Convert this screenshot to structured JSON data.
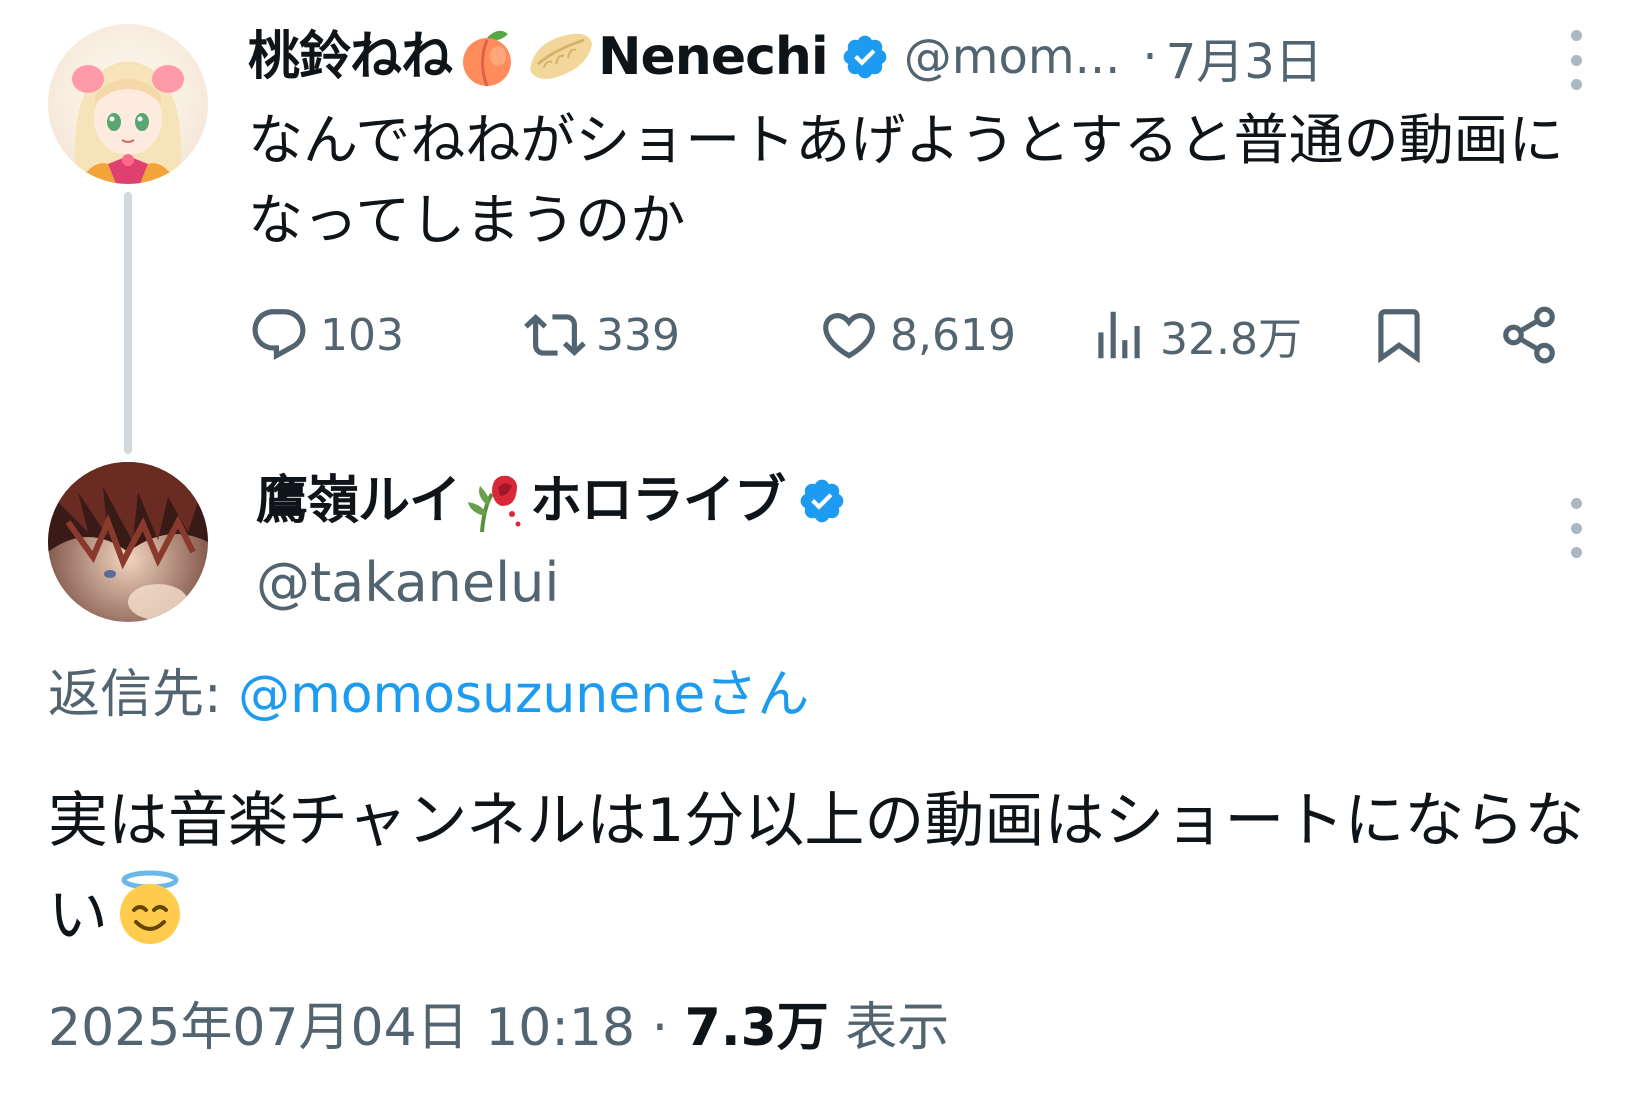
{
  "colors": {
    "text": "#0f1419",
    "secondary": "#536471",
    "link": "#1d9bf0",
    "verified": "#1d9bf0",
    "thread_line": "#cfd9de"
  },
  "tweet1": {
    "display_name": "桃鈴ねね",
    "display_name_suffix": "Nenechi",
    "name_emojis": [
      "peach-emoji",
      "dumpling-emoji"
    ],
    "verified_icon": "verified-badge-icon",
    "handle": "@mom...",
    "separator": "·",
    "date": "7月3日",
    "text": "なんでねねがショートあげようとすると普通の動画になってしまうのか",
    "actions": {
      "reply_icon": "reply-icon",
      "reply_count": "103",
      "retweet_icon": "retweet-icon",
      "retweet_count": "339",
      "like_icon": "heart-icon",
      "like_count": "8,619",
      "views_icon": "views-bar-chart-icon",
      "views_count": "32.8万",
      "bookmark_icon": "bookmark-icon",
      "share_icon": "share-icon"
    }
  },
  "tweet2": {
    "display_name": "鷹嶺ルイ",
    "display_name_suffix": "ホロライブ",
    "name_emojis": [
      "wilted-rose-emoji"
    ],
    "verified_icon": "verified-badge-icon",
    "handle": "@takanelui",
    "reply_to_label": "返信先: ",
    "reply_to_mention": "@momosuzuneneさん",
    "text": "実は音楽チャンネルは1分以上の動画はショートにならない",
    "text_emoji": "smiling-face-with-halo-emoji",
    "timestamp": "2025年07月04日 10:18",
    "timestamp_separator": " · ",
    "views_value": "7.3万",
    "views_label": " 表示"
  }
}
